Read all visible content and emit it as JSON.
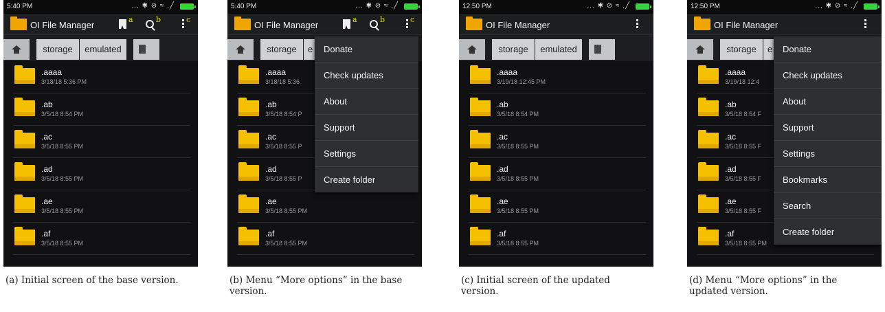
{
  "captions": {
    "a": "(a) Initial screen of the base version.",
    "b": "(b) Menu “More options” in the base version.",
    "c": "(c) Initial screen of the updated version.",
    "d": "(d) Menu “More options” in the updated version."
  },
  "app_title": "OI File Manager",
  "status": {
    "base_time": "5:40 PM",
    "updated_time": "12:50 PM",
    "icons_text": "... ✱ ⊘ ≈ .╱"
  },
  "annotations": {
    "bookmark": "a",
    "search": "b",
    "more": "c"
  },
  "breadcrumb": {
    "storage": "storage",
    "emulated": "emulated",
    "emulated_cut": "e"
  },
  "base_files": [
    {
      "name": ".aaaa",
      "date": "3/18/18 5:36 PM",
      "date_cut": "3/18/18 5:36"
    },
    {
      "name": ".ab",
      "date": "3/5/18 8:54 PM",
      "date_cut": "3/5/18 8:54 P"
    },
    {
      "name": ".ac",
      "date": "3/5/18 8:55 PM",
      "date_cut": "3/5/18 8:55 P"
    },
    {
      "name": ".ad",
      "date": "3/5/18 8:55 PM",
      "date_cut": "3/5/18 8:55 P"
    },
    {
      "name": ".ae",
      "date": "3/5/18 8:55 PM",
      "date_cut": "3/5/18 8:55 PM"
    },
    {
      "name": ".af",
      "date": "3/5/18 8:55 PM",
      "date_cut": "3/5/18 8:55 PM"
    }
  ],
  "updated_files": [
    {
      "name": ".aaaa",
      "date": "3/19/18 12:45 PM",
      "date_cut": "3/19/18 12:4"
    },
    {
      "name": ".ab",
      "date": "3/5/18 8:54 PM",
      "date_cut": "3/5/18 8:54 F"
    },
    {
      "name": ".ac",
      "date": "3/5/18 8:55 PM",
      "date_cut": "3/5/18 8:55 F"
    },
    {
      "name": ".ad",
      "date": "3/5/18 8:55 PM",
      "date_cut": "3/5/18 8:55 F"
    },
    {
      "name": ".ae",
      "date": "3/5/18 8:55 PM",
      "date_cut": "3/5/18 8:55 F"
    },
    {
      "name": ".af",
      "date": "3/5/18 8:55 PM",
      "date_cut": "3/5/18 8:55 PM"
    }
  ],
  "base_menu": [
    "Donate",
    "Check updates",
    "About",
    "Support",
    "Settings",
    "Create folder"
  ],
  "updated_menu": [
    "Donate",
    "Check updates",
    "About",
    "Support",
    "Settings",
    "Bookmarks",
    "Search",
    "Create folder"
  ],
  "colors": {
    "folder": "#f5c000",
    "annotation": "#e3e000",
    "battery": "#35d63b"
  },
  "icons": [
    "home-icon",
    "sd-card-icon",
    "bookmark-icon",
    "search-icon",
    "overflow-menu-icon",
    "folder-icon"
  ]
}
